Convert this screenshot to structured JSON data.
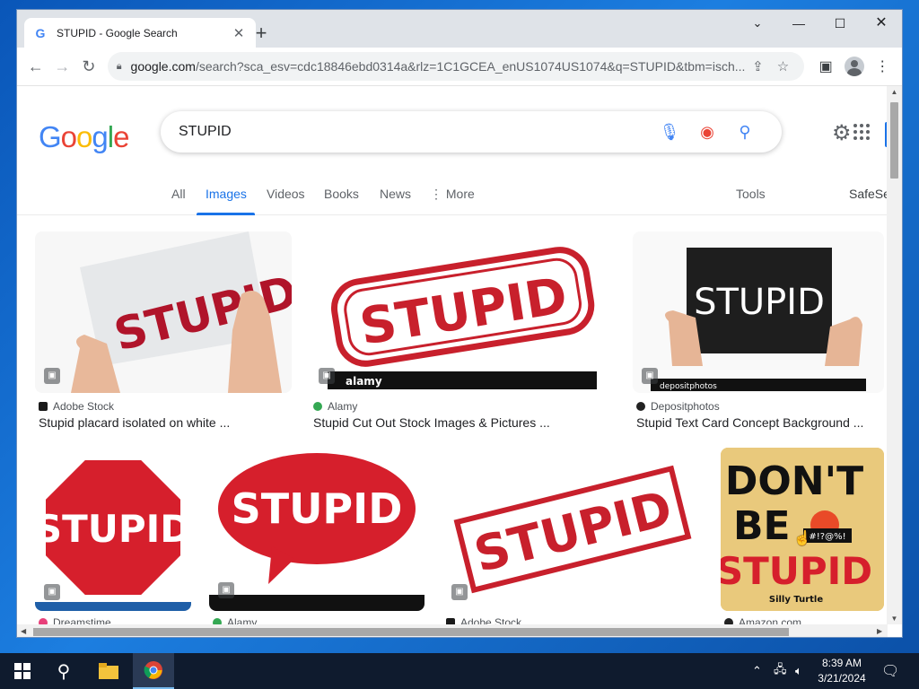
{
  "browser": {
    "tab_title": "STUPID - Google Search",
    "url_host": "google.com",
    "url_rest": "/search?sca_esv=cdc18846ebd0314a&rlz=1C1GCEA_enUS1074US1074&q=STUPID&tbm=isch..."
  },
  "search": {
    "query": "STUPID",
    "tabs": [
      "All",
      "Images",
      "Videos",
      "Books",
      "News",
      "More"
    ],
    "tools_label": "Tools",
    "safesearch_label": "SafeSe"
  },
  "results_row1": [
    {
      "source": "Adobe Stock",
      "caption": "Stupid placard isolated on white ..."
    },
    {
      "source": "Alamy",
      "caption": "Stupid Cut Out Stock Images & Pictures ..."
    },
    {
      "source": "Depositphotos",
      "caption": "Stupid Text Card Concept Background ..."
    }
  ],
  "results_row2": [
    {
      "source": "Dreamstime"
    },
    {
      "source": "Alamy"
    },
    {
      "source": "Adobe Stock"
    },
    {
      "source": "Amazon.com"
    }
  ],
  "image_text": {
    "word": "STUPID",
    "alamy_brand": "alamy",
    "depositphotos_brand": "depositphotos",
    "dont_line1": "DON'T",
    "dont_line2": "BE",
    "dont_line3": "STUPID",
    "symbols": "#!?@%!",
    "silly_turtle": "Silly Turtle"
  },
  "taskbar": {
    "time": "8:39 AM",
    "date": "3/21/2024"
  },
  "colors": {
    "google_blue": "#4285f4",
    "google_red": "#ea4335",
    "google_yellow": "#fbbc05",
    "google_green": "#34a853",
    "stupid_red": "#c0202a"
  }
}
